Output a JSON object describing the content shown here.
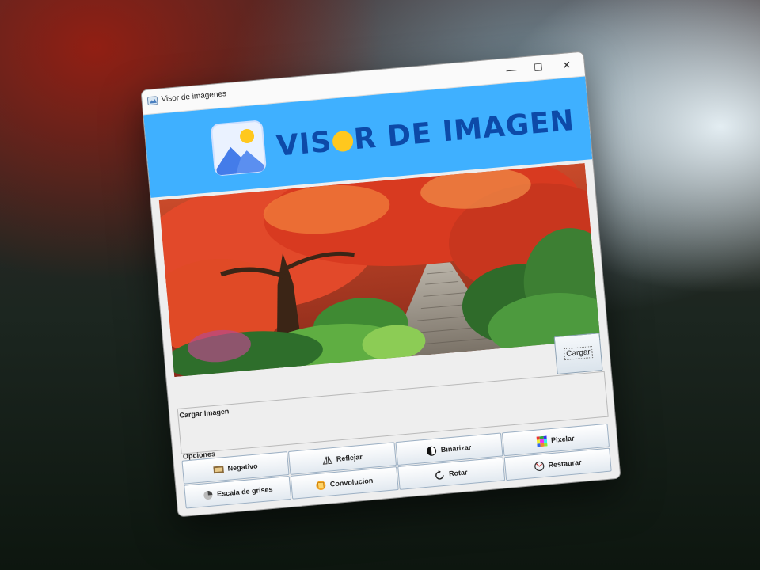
{
  "window": {
    "title": "Visor de imagenes",
    "min_glyph": "—",
    "max_glyph": "☐",
    "close_glyph": "✕"
  },
  "banner": {
    "brand_pre": "VIS",
    "brand_post": "R DE IMAGEN",
    "brand_color": "#0d4aa8",
    "background": "#3fb0ff"
  },
  "load": {
    "button_label": "Cargar",
    "section_label": "Cargar Imagen"
  },
  "options": {
    "section_label": "Opciones",
    "buttons": [
      {
        "label": "Negativo",
        "icon": "negative-icon"
      },
      {
        "label": "Reflejar",
        "icon": "mirror-icon"
      },
      {
        "label": "Binarizar",
        "icon": "contrast-icon"
      },
      {
        "label": "Pixelar",
        "icon": "pixelate-icon"
      },
      {
        "label": "Escala de grises",
        "icon": "grayscale-icon"
      },
      {
        "label": "Convolucion",
        "icon": "convolution-icon"
      },
      {
        "label": "Rotar",
        "icon": "rotate-icon"
      },
      {
        "label": "Restaurar",
        "icon": "restore-icon"
      }
    ]
  }
}
